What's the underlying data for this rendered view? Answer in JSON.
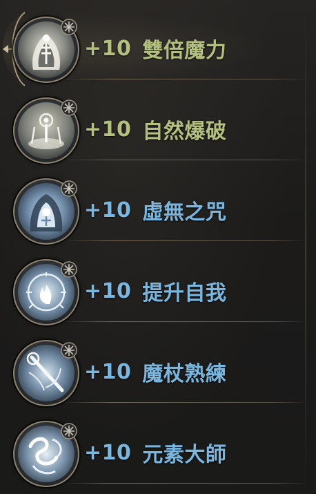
{
  "skills": [
    {
      "bonus": "+10",
      "name": "雙倍魔力",
      "icon": "double-mana-icon",
      "color": "#b4c07e",
      "selected": true,
      "locked": true
    },
    {
      "bonus": "+10",
      "name": "自然爆破",
      "icon": "nature-burst-icon",
      "color": "#b4c07e",
      "selected": false,
      "locked": true
    },
    {
      "bonus": "+10",
      "name": "虛無之咒",
      "icon": "void-curse-icon",
      "color": "#7ab7e0",
      "selected": false,
      "locked": true
    },
    {
      "bonus": "+10",
      "name": "提升自我",
      "icon": "self-empower-icon",
      "color": "#7ab7e0",
      "selected": false,
      "locked": true
    },
    {
      "bonus": "+10",
      "name": "魔杖熟練",
      "icon": "wand-mastery-icon",
      "color": "#7ab7e0",
      "selected": false,
      "locked": true
    },
    {
      "bonus": "+10",
      "name": "元素大師",
      "icon": "element-master-icon",
      "color": "#7ab7e0",
      "selected": false,
      "locked": true
    }
  ]
}
